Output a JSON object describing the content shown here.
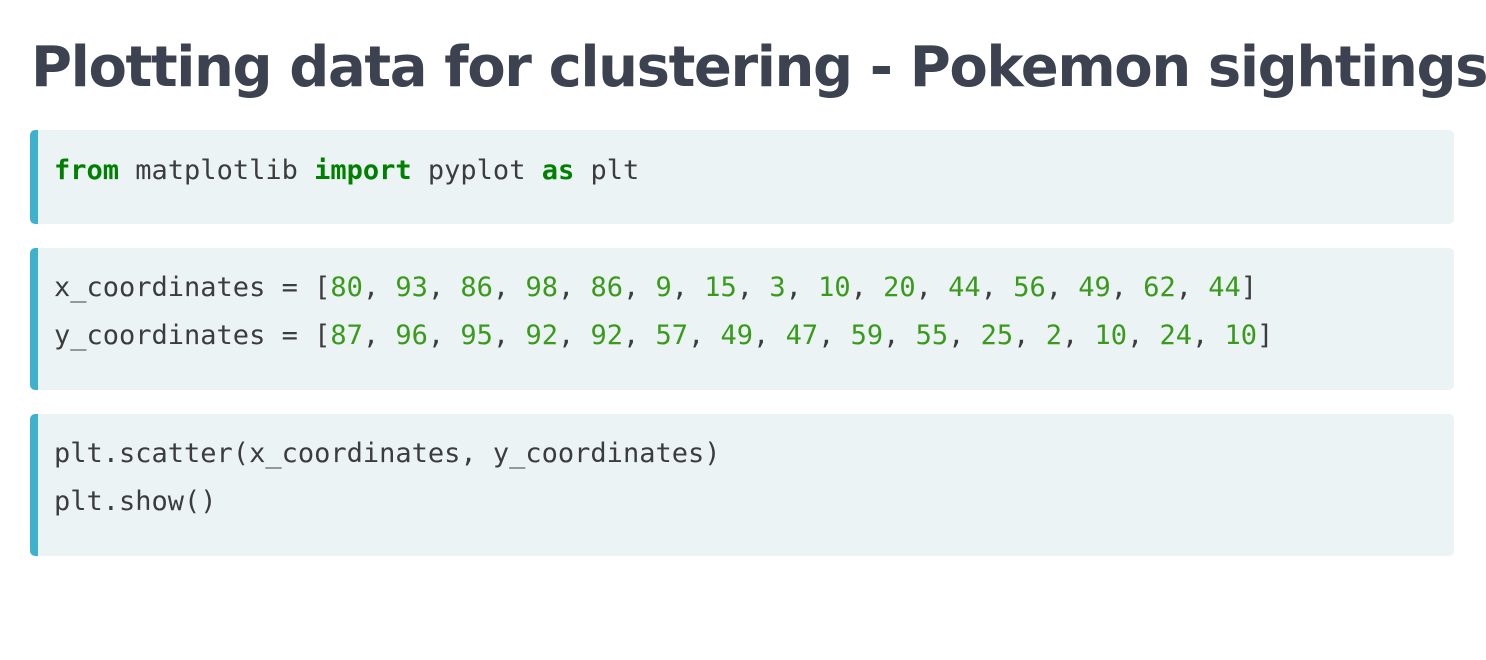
{
  "page": {
    "title": "Plotting data for clustering - Pokemon sightings"
  },
  "colors": {
    "title": "#3d4251",
    "code_background": "#ebf3f5",
    "code_border": "#3eb1cd",
    "keyword": "#008000",
    "number": "#3a9a1c",
    "code_text": "#3c3c3c"
  },
  "cells": [
    {
      "lines": [
        [
          {
            "text": "from",
            "type": "kw"
          },
          {
            "text": " matplotlib ",
            "type": "plain"
          },
          {
            "text": "import",
            "type": "kw"
          },
          {
            "text": " pyplot ",
            "type": "plain"
          },
          {
            "text": "as",
            "type": "kw"
          },
          {
            "text": " plt",
            "type": "plain"
          }
        ]
      ]
    },
    {
      "lines": [
        [
          {
            "text": "x_coordinates = [",
            "type": "plain"
          },
          {
            "text": "80",
            "type": "num"
          },
          {
            "text": ", ",
            "type": "plain"
          },
          {
            "text": "93",
            "type": "num"
          },
          {
            "text": ", ",
            "type": "plain"
          },
          {
            "text": "86",
            "type": "num"
          },
          {
            "text": ", ",
            "type": "plain"
          },
          {
            "text": "98",
            "type": "num"
          },
          {
            "text": ", ",
            "type": "plain"
          },
          {
            "text": "86",
            "type": "num"
          },
          {
            "text": ", ",
            "type": "plain"
          },
          {
            "text": "9",
            "type": "num"
          },
          {
            "text": ", ",
            "type": "plain"
          },
          {
            "text": "15",
            "type": "num"
          },
          {
            "text": ", ",
            "type": "plain"
          },
          {
            "text": "3",
            "type": "num"
          },
          {
            "text": ", ",
            "type": "plain"
          },
          {
            "text": "10",
            "type": "num"
          },
          {
            "text": ", ",
            "type": "plain"
          },
          {
            "text": "20",
            "type": "num"
          },
          {
            "text": ", ",
            "type": "plain"
          },
          {
            "text": "44",
            "type": "num"
          },
          {
            "text": ", ",
            "type": "plain"
          },
          {
            "text": "56",
            "type": "num"
          },
          {
            "text": ", ",
            "type": "plain"
          },
          {
            "text": "49",
            "type": "num"
          },
          {
            "text": ", ",
            "type": "plain"
          },
          {
            "text": "62",
            "type": "num"
          },
          {
            "text": ", ",
            "type": "plain"
          },
          {
            "text": "44",
            "type": "num"
          },
          {
            "text": "]",
            "type": "plain"
          }
        ],
        [
          {
            "text": "y_coordinates = [",
            "type": "plain"
          },
          {
            "text": "87",
            "type": "num"
          },
          {
            "text": ", ",
            "type": "plain"
          },
          {
            "text": "96",
            "type": "num"
          },
          {
            "text": ", ",
            "type": "plain"
          },
          {
            "text": "95",
            "type": "num"
          },
          {
            "text": ", ",
            "type": "plain"
          },
          {
            "text": "92",
            "type": "num"
          },
          {
            "text": ", ",
            "type": "plain"
          },
          {
            "text": "92",
            "type": "num"
          },
          {
            "text": ", ",
            "type": "plain"
          },
          {
            "text": "57",
            "type": "num"
          },
          {
            "text": ", ",
            "type": "plain"
          },
          {
            "text": "49",
            "type": "num"
          },
          {
            "text": ", ",
            "type": "plain"
          },
          {
            "text": "47",
            "type": "num"
          },
          {
            "text": ", ",
            "type": "plain"
          },
          {
            "text": "59",
            "type": "num"
          },
          {
            "text": ", ",
            "type": "plain"
          },
          {
            "text": "55",
            "type": "num"
          },
          {
            "text": ", ",
            "type": "plain"
          },
          {
            "text": "25",
            "type": "num"
          },
          {
            "text": ", ",
            "type": "plain"
          },
          {
            "text": "2",
            "type": "num"
          },
          {
            "text": ", ",
            "type": "plain"
          },
          {
            "text": "10",
            "type": "num"
          },
          {
            "text": ", ",
            "type": "plain"
          },
          {
            "text": "24",
            "type": "num"
          },
          {
            "text": ", ",
            "type": "plain"
          },
          {
            "text": "10",
            "type": "num"
          },
          {
            "text": "]",
            "type": "plain"
          }
        ]
      ]
    },
    {
      "lines": [
        [
          {
            "text": "plt.scatter(x_coordinates, y_coordinates)",
            "type": "plain"
          }
        ],
        [
          {
            "text": "plt.show()",
            "type": "plain"
          }
        ]
      ]
    }
  ]
}
